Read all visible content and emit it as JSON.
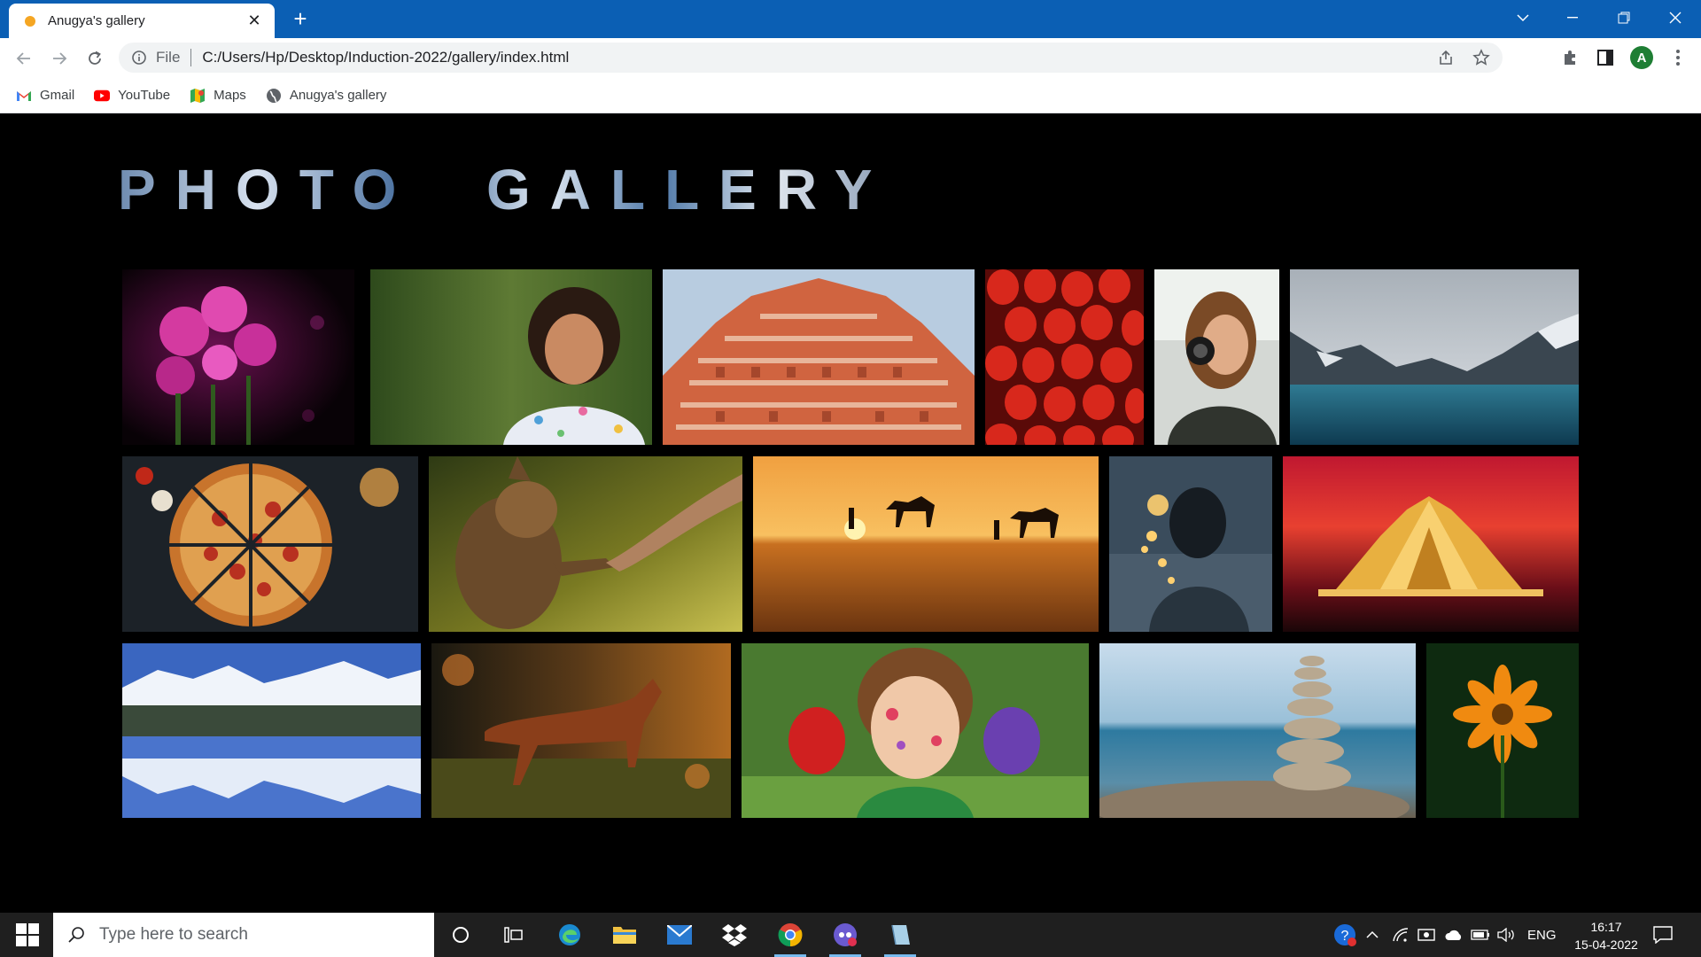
{
  "browser": {
    "tab_title": "Anugya's gallery",
    "new_tab": "+",
    "url_scheme": "File",
    "url": "C:/Users/Hp/Desktop/Induction-2022/gallery/index.html",
    "profile_initial": "A"
  },
  "bookmarks": [
    {
      "label": "Gmail",
      "icon": "gmail-icon"
    },
    {
      "label": "YouTube",
      "icon": "youtube-icon"
    },
    {
      "label": "Maps",
      "icon": "maps-icon"
    },
    {
      "label": "Anugya's gallery",
      "icon": "globe-icon"
    }
  ],
  "page": {
    "heading": "PHOTO  GALLERY",
    "photos": [
      {
        "name": "pink-flowers-photo"
      },
      {
        "name": "smiling-girl-photo"
      },
      {
        "name": "hawa-mahal-photo"
      },
      {
        "name": "strawberries-photo"
      },
      {
        "name": "girl-with-camera-photo"
      },
      {
        "name": "mountain-lake-photo"
      },
      {
        "name": "pizza-photo"
      },
      {
        "name": "dog-paw-hand-photo"
      },
      {
        "name": "desert-camels-photo"
      },
      {
        "name": "girl-lights-photo"
      },
      {
        "name": "lotus-temple-photo"
      },
      {
        "name": "snowy-mountains-reflection-photo"
      },
      {
        "name": "horse-photo"
      },
      {
        "name": "painted-hands-child-photo"
      },
      {
        "name": "stacked-stones-photo"
      },
      {
        "name": "orange-flower-photo"
      }
    ]
  },
  "taskbar": {
    "search_placeholder": "Type here to search",
    "language": "ENG",
    "time": "16:17",
    "date": "15-04-2022"
  }
}
